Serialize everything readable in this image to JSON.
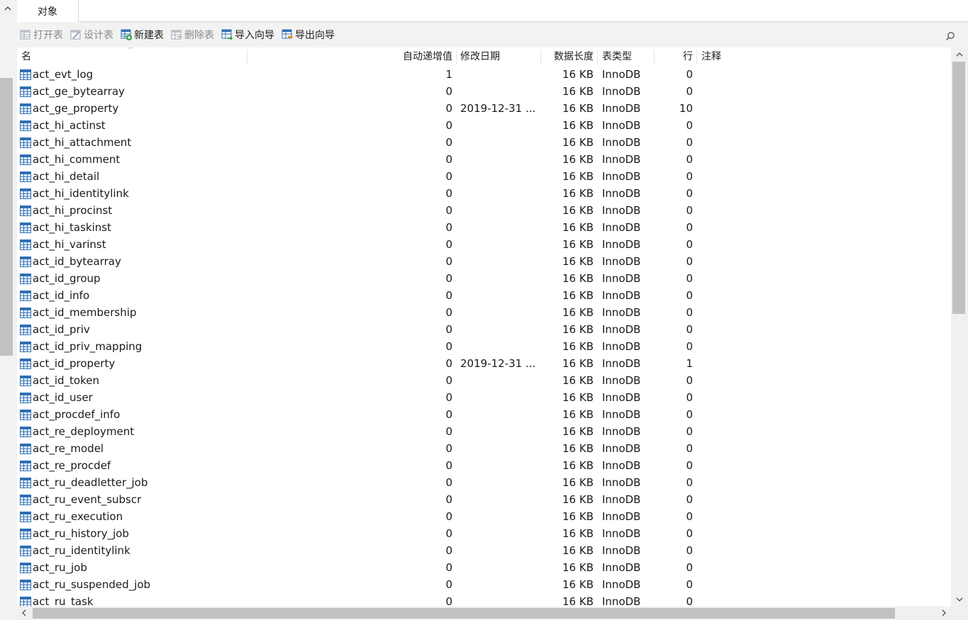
{
  "tabs": {
    "objects_label": "对象",
    "collapse_glyph": "^"
  },
  "toolbar": {
    "open_table": "打开表",
    "design_table": "设计表",
    "new_table": "新建表",
    "delete_table": "删除表",
    "import_wizard": "导入向导",
    "export_wizard": "导出向导"
  },
  "columns": {
    "name": "名",
    "auto_increment": "自动递增值",
    "modified_date": "修改日期",
    "data_length": "数据长度",
    "table_type": "表类型",
    "rows": "行",
    "comment": "注释"
  },
  "sort_caret": "^",
  "scrollbar": {
    "up": "︿",
    "down": "﹀",
    "left": "‹",
    "right": "›"
  },
  "tables": [
    {
      "name": "act_evt_log",
      "auto": "1",
      "date": "",
      "len": "16 KB",
      "type": "InnoDB",
      "rows": "0"
    },
    {
      "name": "act_ge_bytearray",
      "auto": "0",
      "date": "",
      "len": "16 KB",
      "type": "InnoDB",
      "rows": "0"
    },
    {
      "name": "act_ge_property",
      "auto": "0",
      "date": "2019-12-31 ...",
      "len": "16 KB",
      "type": "InnoDB",
      "rows": "10"
    },
    {
      "name": "act_hi_actinst",
      "auto": "0",
      "date": "",
      "len": "16 KB",
      "type": "InnoDB",
      "rows": "0"
    },
    {
      "name": "act_hi_attachment",
      "auto": "0",
      "date": "",
      "len": "16 KB",
      "type": "InnoDB",
      "rows": "0"
    },
    {
      "name": "act_hi_comment",
      "auto": "0",
      "date": "",
      "len": "16 KB",
      "type": "InnoDB",
      "rows": "0"
    },
    {
      "name": "act_hi_detail",
      "auto": "0",
      "date": "",
      "len": "16 KB",
      "type": "InnoDB",
      "rows": "0"
    },
    {
      "name": "act_hi_identitylink",
      "auto": "0",
      "date": "",
      "len": "16 KB",
      "type": "InnoDB",
      "rows": "0"
    },
    {
      "name": "act_hi_procinst",
      "auto": "0",
      "date": "",
      "len": "16 KB",
      "type": "InnoDB",
      "rows": "0"
    },
    {
      "name": "act_hi_taskinst",
      "auto": "0",
      "date": "",
      "len": "16 KB",
      "type": "InnoDB",
      "rows": "0"
    },
    {
      "name": "act_hi_varinst",
      "auto": "0",
      "date": "",
      "len": "16 KB",
      "type": "InnoDB",
      "rows": "0"
    },
    {
      "name": "act_id_bytearray",
      "auto": "0",
      "date": "",
      "len": "16 KB",
      "type": "InnoDB",
      "rows": "0"
    },
    {
      "name": "act_id_group",
      "auto": "0",
      "date": "",
      "len": "16 KB",
      "type": "InnoDB",
      "rows": "0"
    },
    {
      "name": "act_id_info",
      "auto": "0",
      "date": "",
      "len": "16 KB",
      "type": "InnoDB",
      "rows": "0"
    },
    {
      "name": "act_id_membership",
      "auto": "0",
      "date": "",
      "len": "16 KB",
      "type": "InnoDB",
      "rows": "0"
    },
    {
      "name": "act_id_priv",
      "auto": "0",
      "date": "",
      "len": "16 KB",
      "type": "InnoDB",
      "rows": "0"
    },
    {
      "name": "act_id_priv_mapping",
      "auto": "0",
      "date": "",
      "len": "16 KB",
      "type": "InnoDB",
      "rows": "0"
    },
    {
      "name": "act_id_property",
      "auto": "0",
      "date": "2019-12-31 ...",
      "len": "16 KB",
      "type": "InnoDB",
      "rows": "1"
    },
    {
      "name": "act_id_token",
      "auto": "0",
      "date": "",
      "len": "16 KB",
      "type": "InnoDB",
      "rows": "0"
    },
    {
      "name": "act_id_user",
      "auto": "0",
      "date": "",
      "len": "16 KB",
      "type": "InnoDB",
      "rows": "0"
    },
    {
      "name": "act_procdef_info",
      "auto": "0",
      "date": "",
      "len": "16 KB",
      "type": "InnoDB",
      "rows": "0"
    },
    {
      "name": "act_re_deployment",
      "auto": "0",
      "date": "",
      "len": "16 KB",
      "type": "InnoDB",
      "rows": "0"
    },
    {
      "name": "act_re_model",
      "auto": "0",
      "date": "",
      "len": "16 KB",
      "type": "InnoDB",
      "rows": "0"
    },
    {
      "name": "act_re_procdef",
      "auto": "0",
      "date": "",
      "len": "16 KB",
      "type": "InnoDB",
      "rows": "0"
    },
    {
      "name": "act_ru_deadletter_job",
      "auto": "0",
      "date": "",
      "len": "16 KB",
      "type": "InnoDB",
      "rows": "0"
    },
    {
      "name": "act_ru_event_subscr",
      "auto": "0",
      "date": "",
      "len": "16 KB",
      "type": "InnoDB",
      "rows": "0"
    },
    {
      "name": "act_ru_execution",
      "auto": "0",
      "date": "",
      "len": "16 KB",
      "type": "InnoDB",
      "rows": "0"
    },
    {
      "name": "act_ru_history_job",
      "auto": "0",
      "date": "",
      "len": "16 KB",
      "type": "InnoDB",
      "rows": "0"
    },
    {
      "name": "act_ru_identitylink",
      "auto": "0",
      "date": "",
      "len": "16 KB",
      "type": "InnoDB",
      "rows": "0"
    },
    {
      "name": "act_ru_job",
      "auto": "0",
      "date": "",
      "len": "16 KB",
      "type": "InnoDB",
      "rows": "0"
    },
    {
      "name": "act_ru_suspended_job",
      "auto": "0",
      "date": "",
      "len": "16 KB",
      "type": "InnoDB",
      "rows": "0"
    },
    {
      "name": "act_ru_task",
      "auto": "0",
      "date": "",
      "len": "16 KB",
      "type": "InnoDB",
      "rows": "0"
    }
  ],
  "colors": {
    "table_icon": "#2f6fb3",
    "new_badge": "#2e9e3e",
    "scroll_thumb": "#c1c1c1"
  }
}
